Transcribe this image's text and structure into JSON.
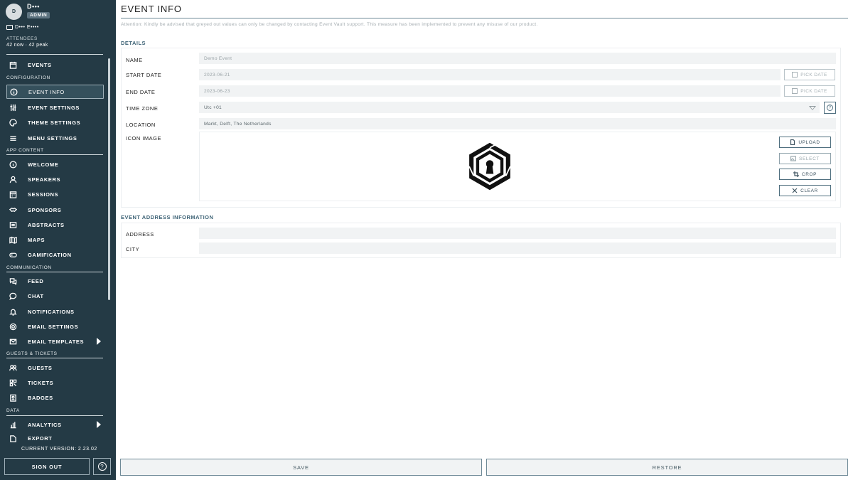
{
  "user": {
    "initial": "D",
    "name": "D•••",
    "role": "ADMIN",
    "event": "D••• E••••"
  },
  "attendees": {
    "label": "ATTENDEES",
    "value": "42 now · 42 peak"
  },
  "sidebar": {
    "sections": {
      "configuration": "CONFIGURATION",
      "app_content": "APP CONTENT",
      "communication": "COMMUNICATION",
      "guests_tickets": "GUESTS & TICKETS",
      "data": "DATA"
    },
    "items": {
      "events": "EVENTS",
      "event_info": "EVENT INFO",
      "event_settings": "EVENT SETTINGS",
      "theme_settings": "THEME SETTINGS",
      "menu_settings": "MENU SETTINGS",
      "welcome": "WELCOME",
      "speakers": "SPEAKERS",
      "sessions": "SESSIONS",
      "sponsors": "SPONSORS",
      "abstracts": "ABSTRACTS",
      "maps": "MAPS",
      "gamification": "GAMIFICATION",
      "feed": "FEED",
      "chat": "CHAT",
      "notifications": "NOTIFICATIONS",
      "email_settings": "EMAIL SETTINGS",
      "email_templates": "EMAIL TEMPLATES",
      "guests": "GUESTS",
      "tickets": "TICKETS",
      "badges": "BADGES",
      "analytics": "ANALYTICS",
      "export": "EXPORT"
    },
    "version": "CURRENT VERSION: 2.23.02",
    "sign_out": "SIGN OUT",
    "help": "?"
  },
  "main": {
    "title": "EVENT INFO",
    "attention": "Attention: Kindly be advised that greyed out values can only be changed by contacting Event Vault support. This measure has been implemented to prevent any misuse of our product.",
    "details_title": "DETAILS",
    "fields": {
      "name_label": "NAME",
      "name_value": "Demo Event",
      "start_label": "START DATE",
      "start_value": "2023-06-21",
      "end_label": "END DATE",
      "end_value": "2023-06-23",
      "tz_label": "TIME ZONE",
      "tz_value": "Utc +01",
      "location_label": "LOCATION",
      "location_value": "Markt, Delft, The Netherlands",
      "icon_label": "ICON IMAGE"
    },
    "pick_date": "PICK DATE",
    "tz_help": "?",
    "image_buttons": {
      "upload": "UPLOAD",
      "select": "SELECT",
      "crop": "CROP",
      "clear": "CLEAR"
    },
    "address_title": "EVENT ADDRESS INFORMATION",
    "address_fields": {
      "address_label": "ADDRESS",
      "address_value": "",
      "city_label": "CITY",
      "city_value": ""
    },
    "save": "SAVE",
    "restore": "RESTORE"
  }
}
